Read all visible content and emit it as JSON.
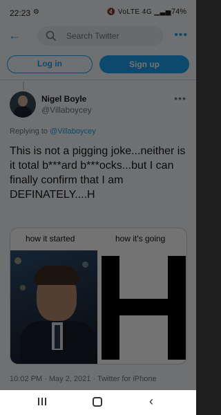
{
  "status": {
    "time": "22:23",
    "indicators": "🔇 VoLTE 4G ▁▃▅",
    "battery": "74%"
  },
  "header": {
    "search_placeholder": "Search Twitter"
  },
  "auth": {
    "login_label": "Log in",
    "signup_label": "Sign up"
  },
  "tweet": {
    "author_name": "Nigel Boyle",
    "author_handle": "@Villaboycey",
    "replying_prefix": "Replying to ",
    "replying_to": "@Villaboycey",
    "text": "This is not a pigging joke...neither is it total b***ard b***ocks...but I can finally confirm that I am DEFINATELY....H",
    "media": {
      "caption_left": "how it started",
      "caption_right": "how it's going",
      "letter": "H"
    },
    "timestamp": "10:02 PM · May 2, 2021 · Twitter for iPhone"
  },
  "colors": {
    "accent": "#1da1f2",
    "muted": "#657786"
  }
}
